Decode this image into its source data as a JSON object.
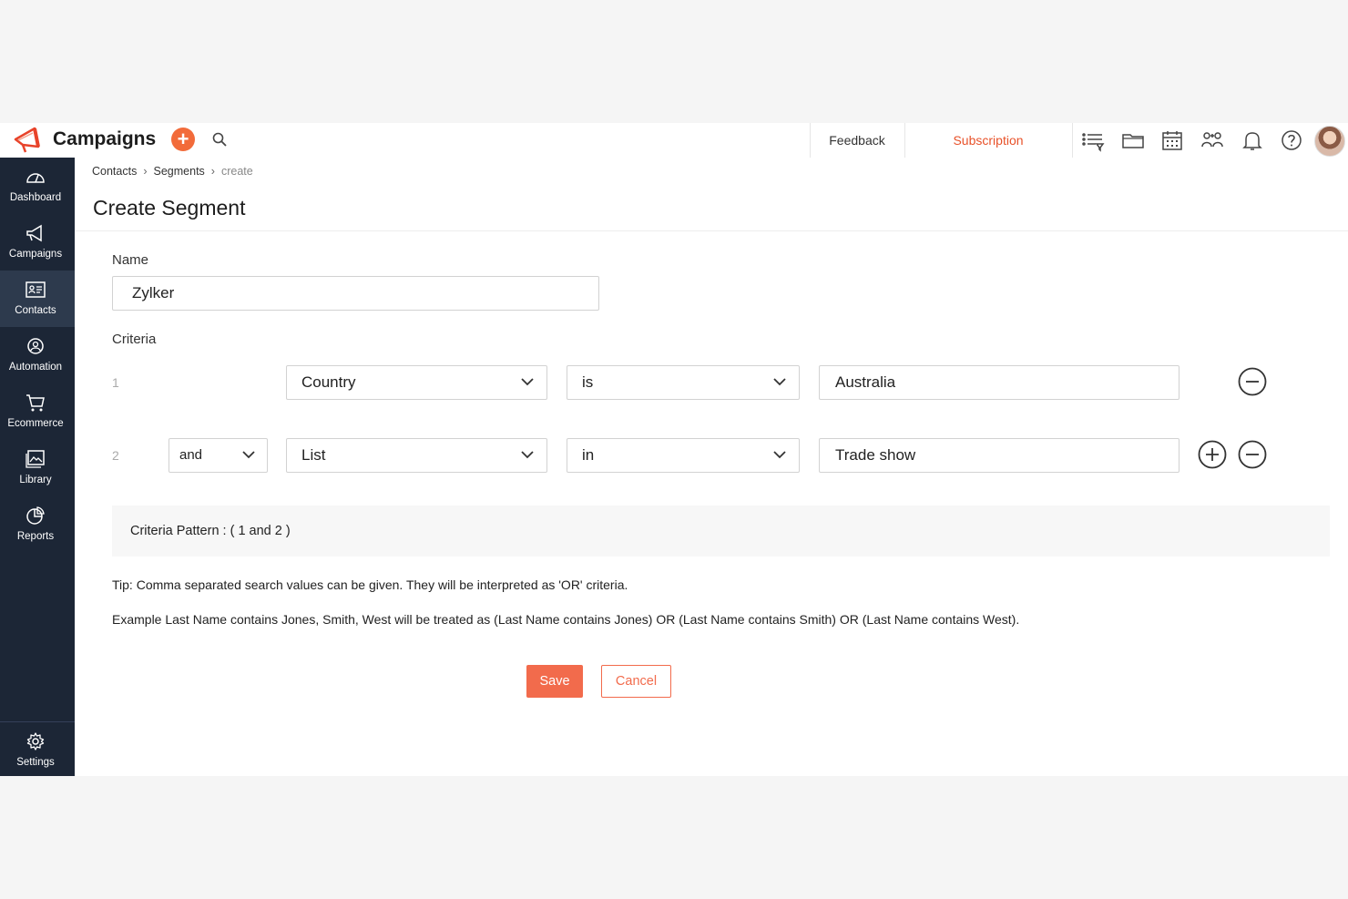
{
  "topbar": {
    "app_name": "Campaigns",
    "add_label": "+",
    "feedback": "Feedback",
    "subscription": "Subscription"
  },
  "sidebar": {
    "items": [
      {
        "label": "Dashboard",
        "icon": "dashboard-icon"
      },
      {
        "label": "Campaigns",
        "icon": "megaphone-icon"
      },
      {
        "label": "Contacts",
        "icon": "contact-card-icon",
        "active": true
      },
      {
        "label": "Automation",
        "icon": "automation-icon"
      },
      {
        "label": "Ecommerce",
        "icon": "cart-icon"
      },
      {
        "label": "Library",
        "icon": "image-library-icon"
      },
      {
        "label": "Reports",
        "icon": "pie-chart-icon"
      }
    ],
    "settings_label": "Settings"
  },
  "breadcrumb": {
    "contacts": "Contacts",
    "segments": "Segments",
    "current": "create"
  },
  "page": {
    "title": "Create Segment",
    "name_label": "Name",
    "name_value": "Zylker",
    "criteria_label": "Criteria"
  },
  "criteria": [
    {
      "index": "1",
      "field": "Country",
      "operator": "is",
      "value": "Australia"
    },
    {
      "index": "2",
      "connector": "and",
      "field": "List",
      "operator": "in",
      "value": "Trade show"
    }
  ],
  "pattern": "Criteria Pattern : ( 1 and 2 )",
  "tip": "Tip: Comma separated search values can be given. They will be interpreted as 'OR' criteria.",
  "example": "Example  Last Name contains Jones, Smith, West will be treated as (Last Name contains Jones) OR (Last Name contains Smith) OR (Last Name contains West).",
  "actions": {
    "save": "Save",
    "cancel": "Cancel"
  },
  "colors": {
    "accent": "#f26b4c",
    "sidebar": "#1c2636",
    "subscription": "#e8522a"
  }
}
